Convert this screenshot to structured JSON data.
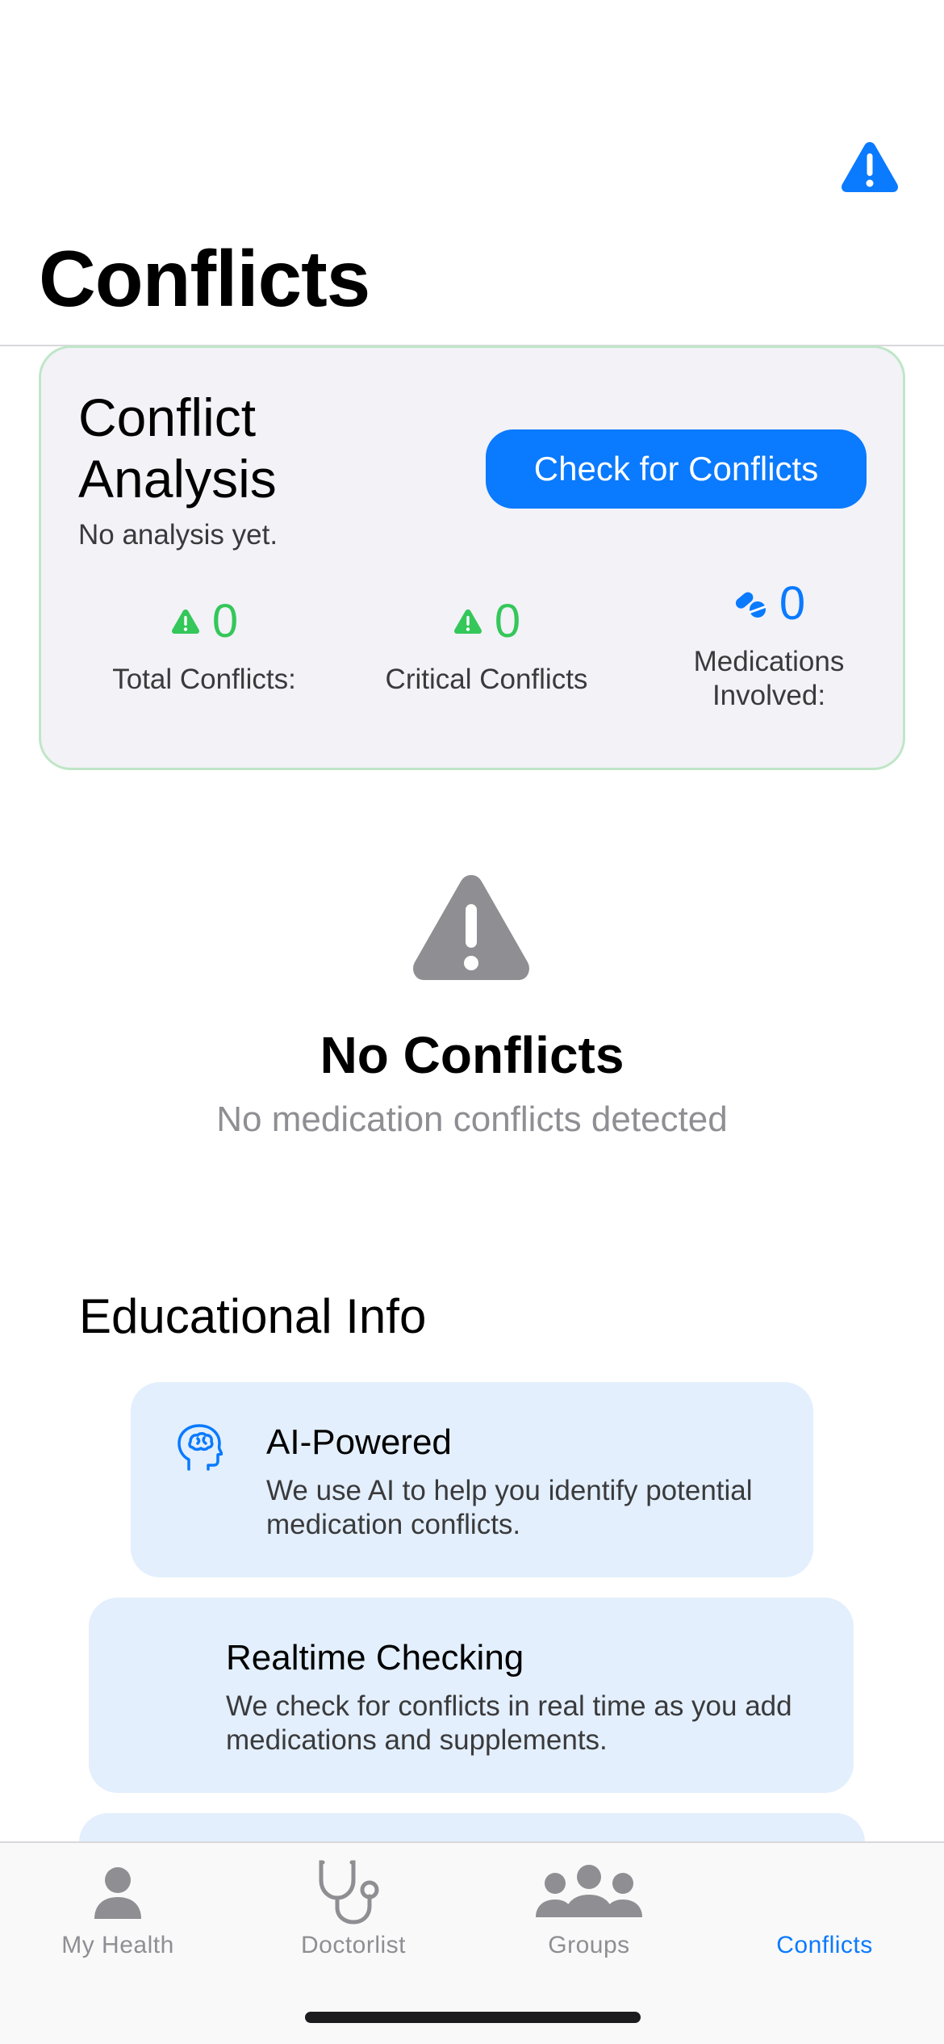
{
  "colors": {
    "accent": "#0a7aff",
    "success": "#34c759",
    "card_border": "#bfe6c7",
    "edu_card_bg": "#e3effc",
    "muted": "#8e8e93"
  },
  "header": {
    "title": "Conflicts",
    "alert_icon": "exclamation-triangle-icon"
  },
  "analysis": {
    "title": "Conflict Analysis",
    "status": "No analysis yet.",
    "check_button": "Check for Conflicts",
    "stats": [
      {
        "value": "0",
        "label": "Total Conflicts:",
        "icon": "warning-triangle-icon",
        "color": "#34c759"
      },
      {
        "value": "0",
        "label": "Critical Conflicts",
        "icon": "warning-triangle-icon",
        "color": "#34c759"
      },
      {
        "value": "0",
        "label": "Medications Involved:",
        "icon": "pills-icon",
        "color": "#0a7aff"
      }
    ]
  },
  "empty_state": {
    "icon": "exclamation-triangle-icon",
    "title": "No Conflicts",
    "subtitle": "No medication conflicts detected"
  },
  "educational": {
    "heading": "Educational Info",
    "cards": [
      {
        "title": "AI-Powered",
        "body": "We use AI to help you identify potential medication conflicts.",
        "icon": "brain-head-icon"
      },
      {
        "title": "Realtime Checking",
        "body": "We check for conflicts in real time as you add medications and supplements."
      }
    ]
  },
  "tab_bar": {
    "tabs": [
      {
        "label": "My Health",
        "icon": "person-icon",
        "active": false
      },
      {
        "label": "Doctorlist",
        "icon": "stethoscope-icon",
        "active": false
      },
      {
        "label": "Groups",
        "icon": "people-group-icon",
        "active": false
      },
      {
        "label": "Conflicts",
        "icon": "conflicts-icon",
        "active": true
      }
    ]
  }
}
